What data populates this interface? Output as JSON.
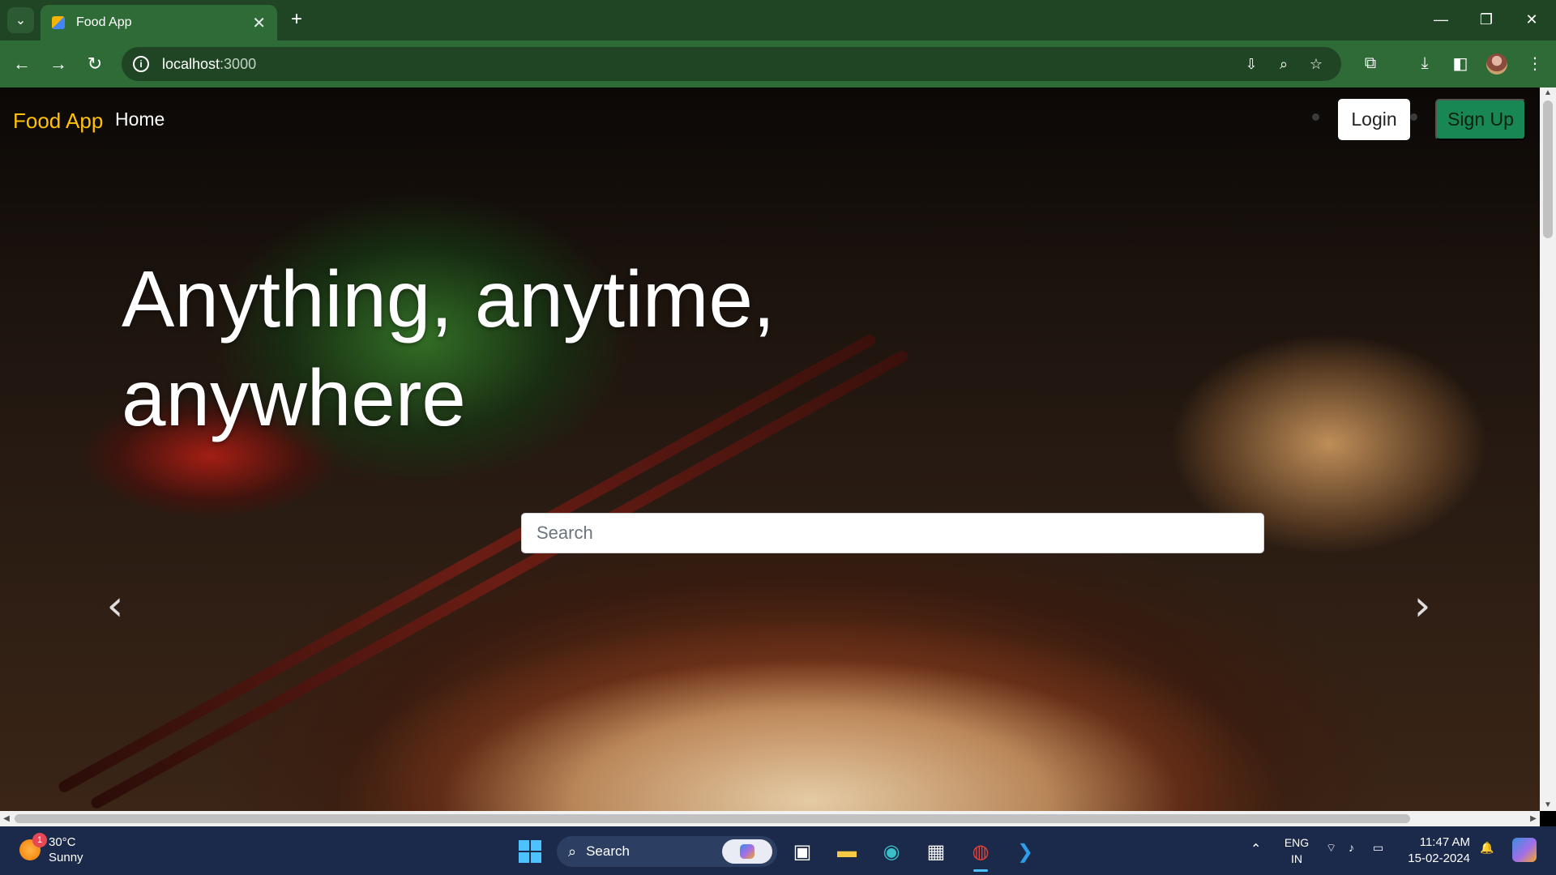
{
  "browser": {
    "tab_title": "Food App",
    "tab_close": "✕",
    "new_tab": "+",
    "url_host": "localhost",
    "url_port": ":3000",
    "info_icon": "i"
  },
  "page": {
    "brand": "Food App",
    "nav_home": "Home",
    "login_label": "Login",
    "signup_label": "Sign Up",
    "headline_line1": "Anything, anytime,",
    "headline_line2": "anywhere",
    "search_placeholder": "Search",
    "prev_glyph": "‹",
    "next_glyph": "›"
  },
  "taskbar": {
    "weather_temp": "30°C",
    "weather_desc": "Sunny",
    "weather_badge": "1",
    "search_label": "Search",
    "lang_top": "ENG",
    "lang_bottom": "IN",
    "time": "11:47 AM",
    "date": "15-02-2024"
  },
  "colors": {
    "brand": "#ffc107",
    "signup_bg": "#198754",
    "chrome_frame": "#1f4524",
    "chrome_toolbar": "#2e6b37",
    "taskbar": "#1b2a4a"
  }
}
